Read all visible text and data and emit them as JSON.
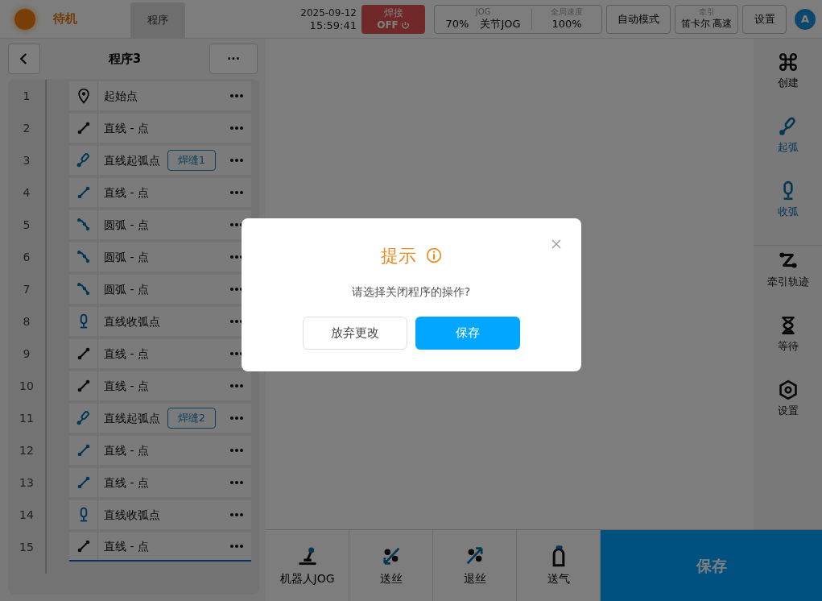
{
  "status": {
    "label": "待机"
  },
  "tabs": [
    {
      "label": "程序",
      "selected": true
    }
  ],
  "clock": {
    "date": "2025-09-12",
    "time": "15:59:41"
  },
  "weld": {
    "label": "焊接",
    "state": "OFF",
    "on": false
  },
  "jog": {
    "label": "JOG",
    "value": "70%",
    "mode": "关节JOG",
    "speed_label": "全局速度",
    "speed": "100%"
  },
  "mode_button": "自动模式",
  "traction": {
    "label": "牵引",
    "value": "笛卡尔 高速"
  },
  "settings_button": "设置",
  "avatar": "A",
  "program": {
    "title": "程序3",
    "more": "···",
    "rows": [
      {
        "index": "1",
        "kind": "start",
        "accent": false,
        "label": "起始点",
        "selected": false
      },
      {
        "index": "2",
        "kind": "line",
        "accent": false,
        "label": "直线 - 点",
        "selected": false
      },
      {
        "index": "3",
        "kind": "arc_start",
        "accent": true,
        "label": "直线起弧点",
        "tag": "焊缝1",
        "selected": false
      },
      {
        "index": "4",
        "kind": "line",
        "accent": true,
        "label": "直线 - 点",
        "selected": false
      },
      {
        "index": "5",
        "kind": "arc",
        "accent": true,
        "label": "圆弧 - 点",
        "selected": false
      },
      {
        "index": "6",
        "kind": "arc",
        "accent": true,
        "label": "圆弧 - 点",
        "selected": false
      },
      {
        "index": "7",
        "kind": "arc",
        "accent": true,
        "label": "圆弧 - 点",
        "selected": false
      },
      {
        "index": "8",
        "kind": "arc_end",
        "accent": true,
        "label": "直线收弧点",
        "selected": false
      },
      {
        "index": "9",
        "kind": "line",
        "accent": false,
        "label": "直线 - 点",
        "selected": false
      },
      {
        "index": "10",
        "kind": "line",
        "accent": false,
        "label": "直线 - 点",
        "selected": false
      },
      {
        "index": "11",
        "kind": "arc_start",
        "accent": true,
        "label": "直线起弧点",
        "tag": "焊缝2",
        "selected": false
      },
      {
        "index": "12",
        "kind": "line",
        "accent": true,
        "label": "直线 - 点",
        "selected": false
      },
      {
        "index": "13",
        "kind": "line",
        "accent": true,
        "label": "直线 - 点",
        "selected": false
      },
      {
        "index": "14",
        "kind": "arc_end",
        "accent": true,
        "label": "直线收弧点",
        "selected": false
      },
      {
        "index": "15",
        "kind": "line",
        "accent": false,
        "label": "直线 - 点",
        "selected": true
      }
    ]
  },
  "tools": [
    {
      "kind": "create",
      "label": "创建",
      "accent": false
    },
    {
      "kind": "arc_start",
      "label": "起弧",
      "accent": true
    },
    {
      "kind": "arc_end",
      "label": "收弧",
      "accent": true
    },
    {
      "kind": "trace",
      "label": "牵引轨迹",
      "accent": false
    },
    {
      "kind": "wait",
      "label": "等待",
      "accent": false
    },
    {
      "kind": "settings",
      "label": "设置",
      "accent": false
    }
  ],
  "bottom_actions": [
    {
      "kind": "jog",
      "label": "机器人JOG"
    },
    {
      "kind": "feed",
      "label": "送丝"
    },
    {
      "kind": "retract",
      "label": "退丝"
    },
    {
      "kind": "gas",
      "label": "送气"
    }
  ],
  "save_button": "保存",
  "dialog": {
    "title": "提示",
    "message": "请选择关闭程序的操作?",
    "buttons": [
      {
        "label": "放弃更改",
        "kind": "secondary"
      },
      {
        "label": "保存",
        "kind": "primary"
      }
    ]
  }
}
